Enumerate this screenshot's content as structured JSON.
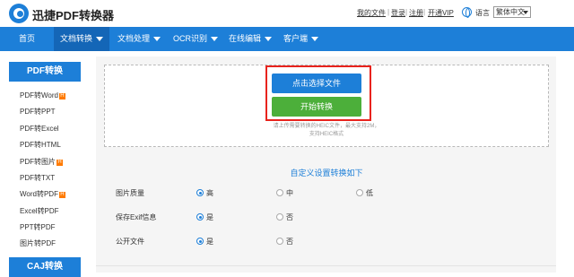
{
  "header": {
    "brand": "迅捷PDF转换器",
    "links": [
      "我的文件",
      "登录",
      "注册",
      "开通VIP"
    ],
    "language_label": "语言",
    "language_selected": "繁体中文"
  },
  "nav": {
    "items": [
      "首页",
      "文档转换",
      "文档处理",
      "OCR识别",
      "在线编辑",
      "客户端"
    ]
  },
  "sidebar": {
    "section1_title": "PDF转换",
    "items": [
      "PDF转Word",
      "PDF转PPT",
      "PDF转Excel",
      "PDF转HTML",
      "PDF转图片",
      "PDF转TXT",
      "Word转PDF",
      "Excel转PDF",
      "PPT转PDF",
      "图片转PDF"
    ],
    "hot_badge": "H",
    "section2_title": "CAJ转换"
  },
  "upload": {
    "select_button": "点击选择文件",
    "start_button": "开始转换",
    "hint_line1": "请上传需要转换的HEIC文件，最大支持2M，",
    "hint_line2": "支持HEIC格式"
  },
  "settings": {
    "title": "自定义设置转换如下",
    "rows": [
      {
        "label": "图片质量",
        "options": [
          "高",
          "中",
          "低"
        ],
        "selected": "高"
      },
      {
        "label": "保存Exif信息",
        "options": [
          "是",
          "否"
        ],
        "selected": "是"
      },
      {
        "label": "公开文件",
        "options": [
          "是",
          "否"
        ],
        "selected": "是"
      }
    ]
  },
  "colors": {
    "primary": "#1d7fd8",
    "nav_active": "#1466b7",
    "start_green": "#4caf3a",
    "highlight_red": "#e8231d",
    "hot_orange": "#ff7a00"
  }
}
